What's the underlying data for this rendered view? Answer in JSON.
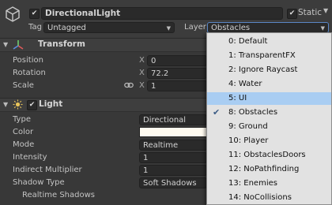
{
  "header": {
    "object_name": "DirectionalLight",
    "active_checked": true,
    "static_label": "Static",
    "static_checked": true,
    "tag_label": "Tag",
    "tag_value": "Untagged",
    "layer_label": "Layer",
    "layer_value": "Obstacles"
  },
  "transform": {
    "title": "Transform",
    "rows": [
      {
        "label": "Position",
        "axis": "X",
        "value": "0"
      },
      {
        "label": "Rotation",
        "axis": "X",
        "value": "72.2"
      },
      {
        "label": "Scale",
        "axis": "X",
        "value": "1"
      }
    ]
  },
  "light": {
    "title": "Light",
    "enabled": true,
    "rows": [
      {
        "label": "Type",
        "value": "Directional"
      },
      {
        "label": "Color",
        "value": ""
      },
      {
        "label": "Mode",
        "value": "Realtime"
      },
      {
        "label": "Intensity",
        "value": "1"
      },
      {
        "label": "Indirect Multiplier",
        "value": "1"
      },
      {
        "label": "Shadow Type",
        "value": "Soft Shadows"
      }
    ],
    "sub_label": "Realtime Shadows"
  },
  "layer_menu": {
    "items": [
      "0: Default",
      "1: TransparentFX",
      "2: Ignore Raycast",
      "4: Water",
      "5: UI",
      "8: Obstacles",
      "9: Ground",
      "10: Player",
      "11: ObstaclesDoors",
      "12: NoPathfinding",
      "13: Enemies",
      "14: NoCollisions"
    ],
    "highlighted": "5: UI",
    "checked": "8: Obstacles"
  },
  "colors": {
    "panel": "#383838",
    "menu_bg": "#e2e2e2",
    "menu_highlight": "#a9cdf2",
    "light_color": "#fffbf0"
  }
}
